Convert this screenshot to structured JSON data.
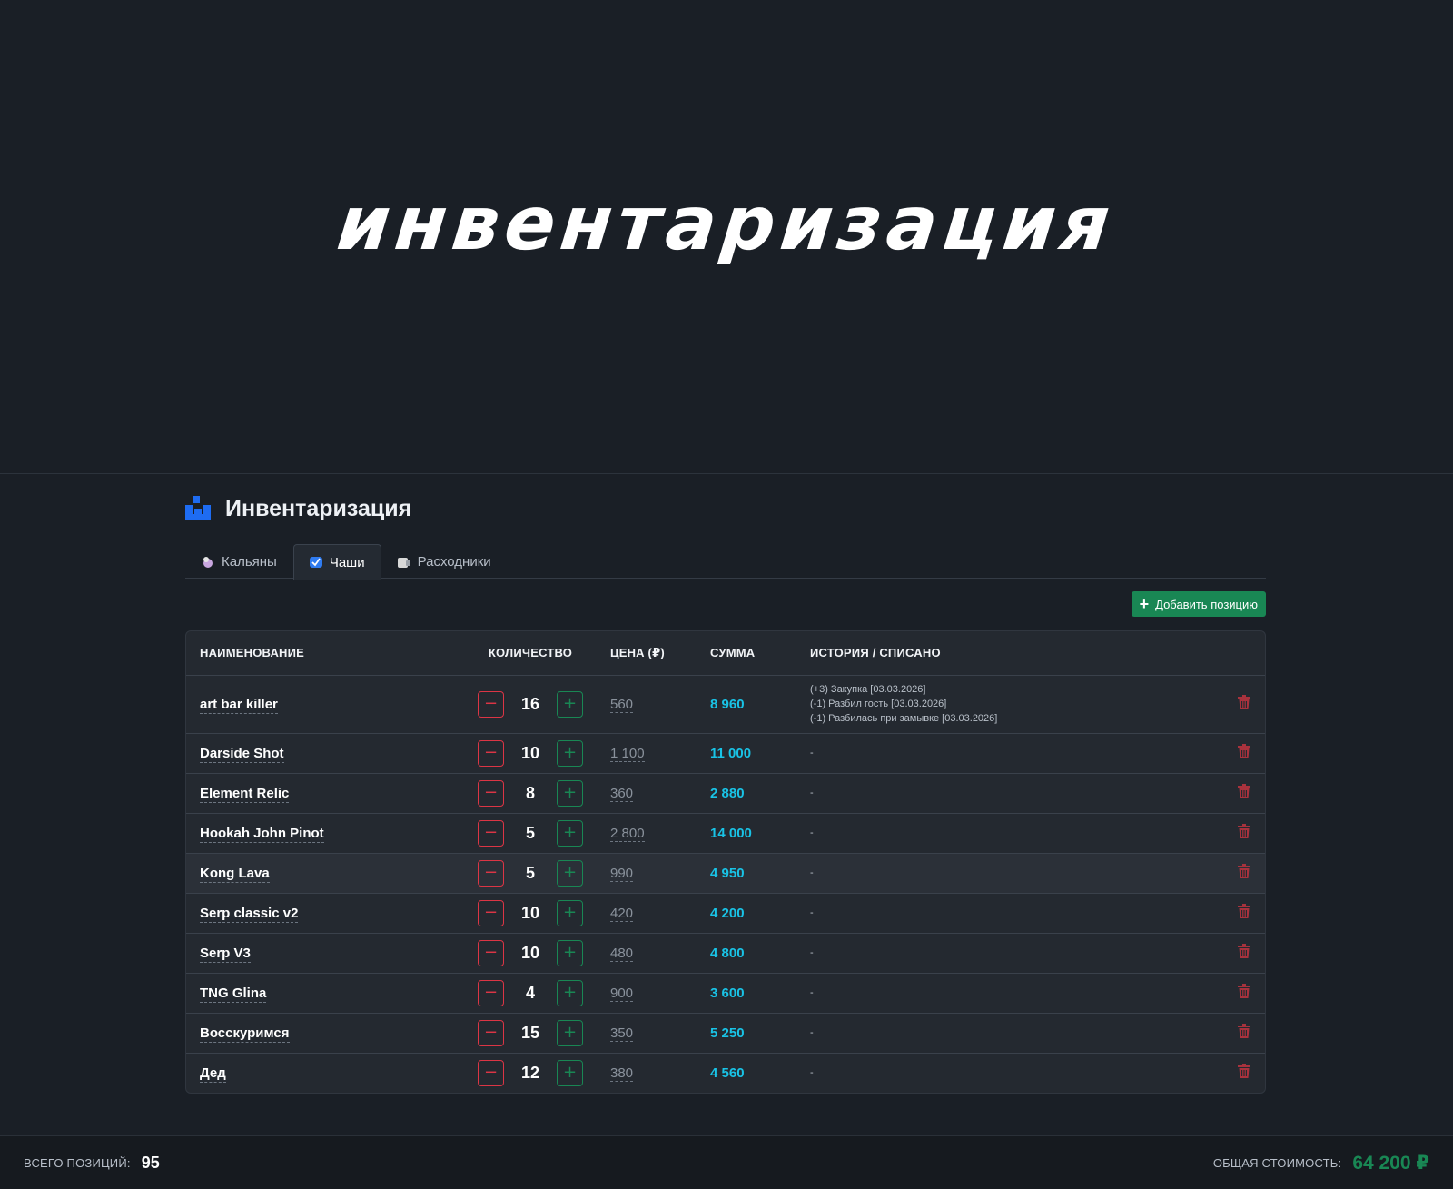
{
  "hero": {
    "title": "инвентаризация"
  },
  "page": {
    "title": "Инвентаризация"
  },
  "tabs": [
    {
      "label": "Кальяны",
      "icon": "hookah-icon"
    },
    {
      "label": "Чаши",
      "icon": "bowl-icon",
      "active": true
    },
    {
      "label": "Расходники",
      "icon": "consumables-icon"
    }
  ],
  "toolbar": {
    "add_label": "Добавить позицию"
  },
  "table": {
    "headers": {
      "name": "НАИМЕНОВАНИЕ",
      "qty": "КОЛИЧЕСТВО",
      "price": "ЦЕНА (₽)",
      "sum": "СУММА",
      "history": "ИСТОРИЯ / СПИСАНО"
    },
    "minus": "−",
    "plus": "+",
    "rows": [
      {
        "name": "art bar killer",
        "qty": "16",
        "price": "560",
        "sum": "8 960",
        "history": [
          "(+3) Закупка [03.03.2026]",
          "(-1) Разбил гость [03.03.2026]",
          "(-1) Разбилась при замывке [03.03.2026]"
        ]
      },
      {
        "name": "Darside Shot",
        "qty": "10",
        "price": "1 100",
        "sum": "11 000",
        "history": [
          "-"
        ]
      },
      {
        "name": "Element Relic",
        "qty": "8",
        "price": "360",
        "sum": "2 880",
        "history": [
          "-"
        ]
      },
      {
        "name": "Hookah John Pinot",
        "qty": "5",
        "price": "2 800",
        "sum": "14 000",
        "history": [
          "-"
        ]
      },
      {
        "name": "Kong Lava",
        "qty": "5",
        "price": "990",
        "sum": "4 950",
        "history": [
          "-"
        ]
      },
      {
        "name": "Serp classic v2",
        "qty": "10",
        "price": "420",
        "sum": "4 200",
        "history": [
          "-"
        ]
      },
      {
        "name": "Serp V3",
        "qty": "10",
        "price": "480",
        "sum": "4 800",
        "history": [
          "-"
        ]
      },
      {
        "name": "TNG Glina",
        "qty": "4",
        "price": "900",
        "sum": "3 600",
        "history": [
          "-"
        ]
      },
      {
        "name": "Восскуримся",
        "qty": "15",
        "price": "350",
        "sum": "5 250",
        "history": [
          "-"
        ]
      },
      {
        "name": "Дед",
        "qty": "12",
        "price": "380",
        "sum": "4 560",
        "history": [
          "-"
        ]
      }
    ]
  },
  "footer": {
    "count_label": "ВСЕГО ПОЗИЦИЙ:",
    "count_value": "95",
    "total_label": "ОБЩАЯ СТОИМОСТЬ:",
    "total_value": "64 200 ₽"
  },
  "colors": {
    "accent_green": "#198754",
    "danger": "#dc3545",
    "sum": "#19c3e6",
    "icon_blue": "#1e6cf2"
  }
}
